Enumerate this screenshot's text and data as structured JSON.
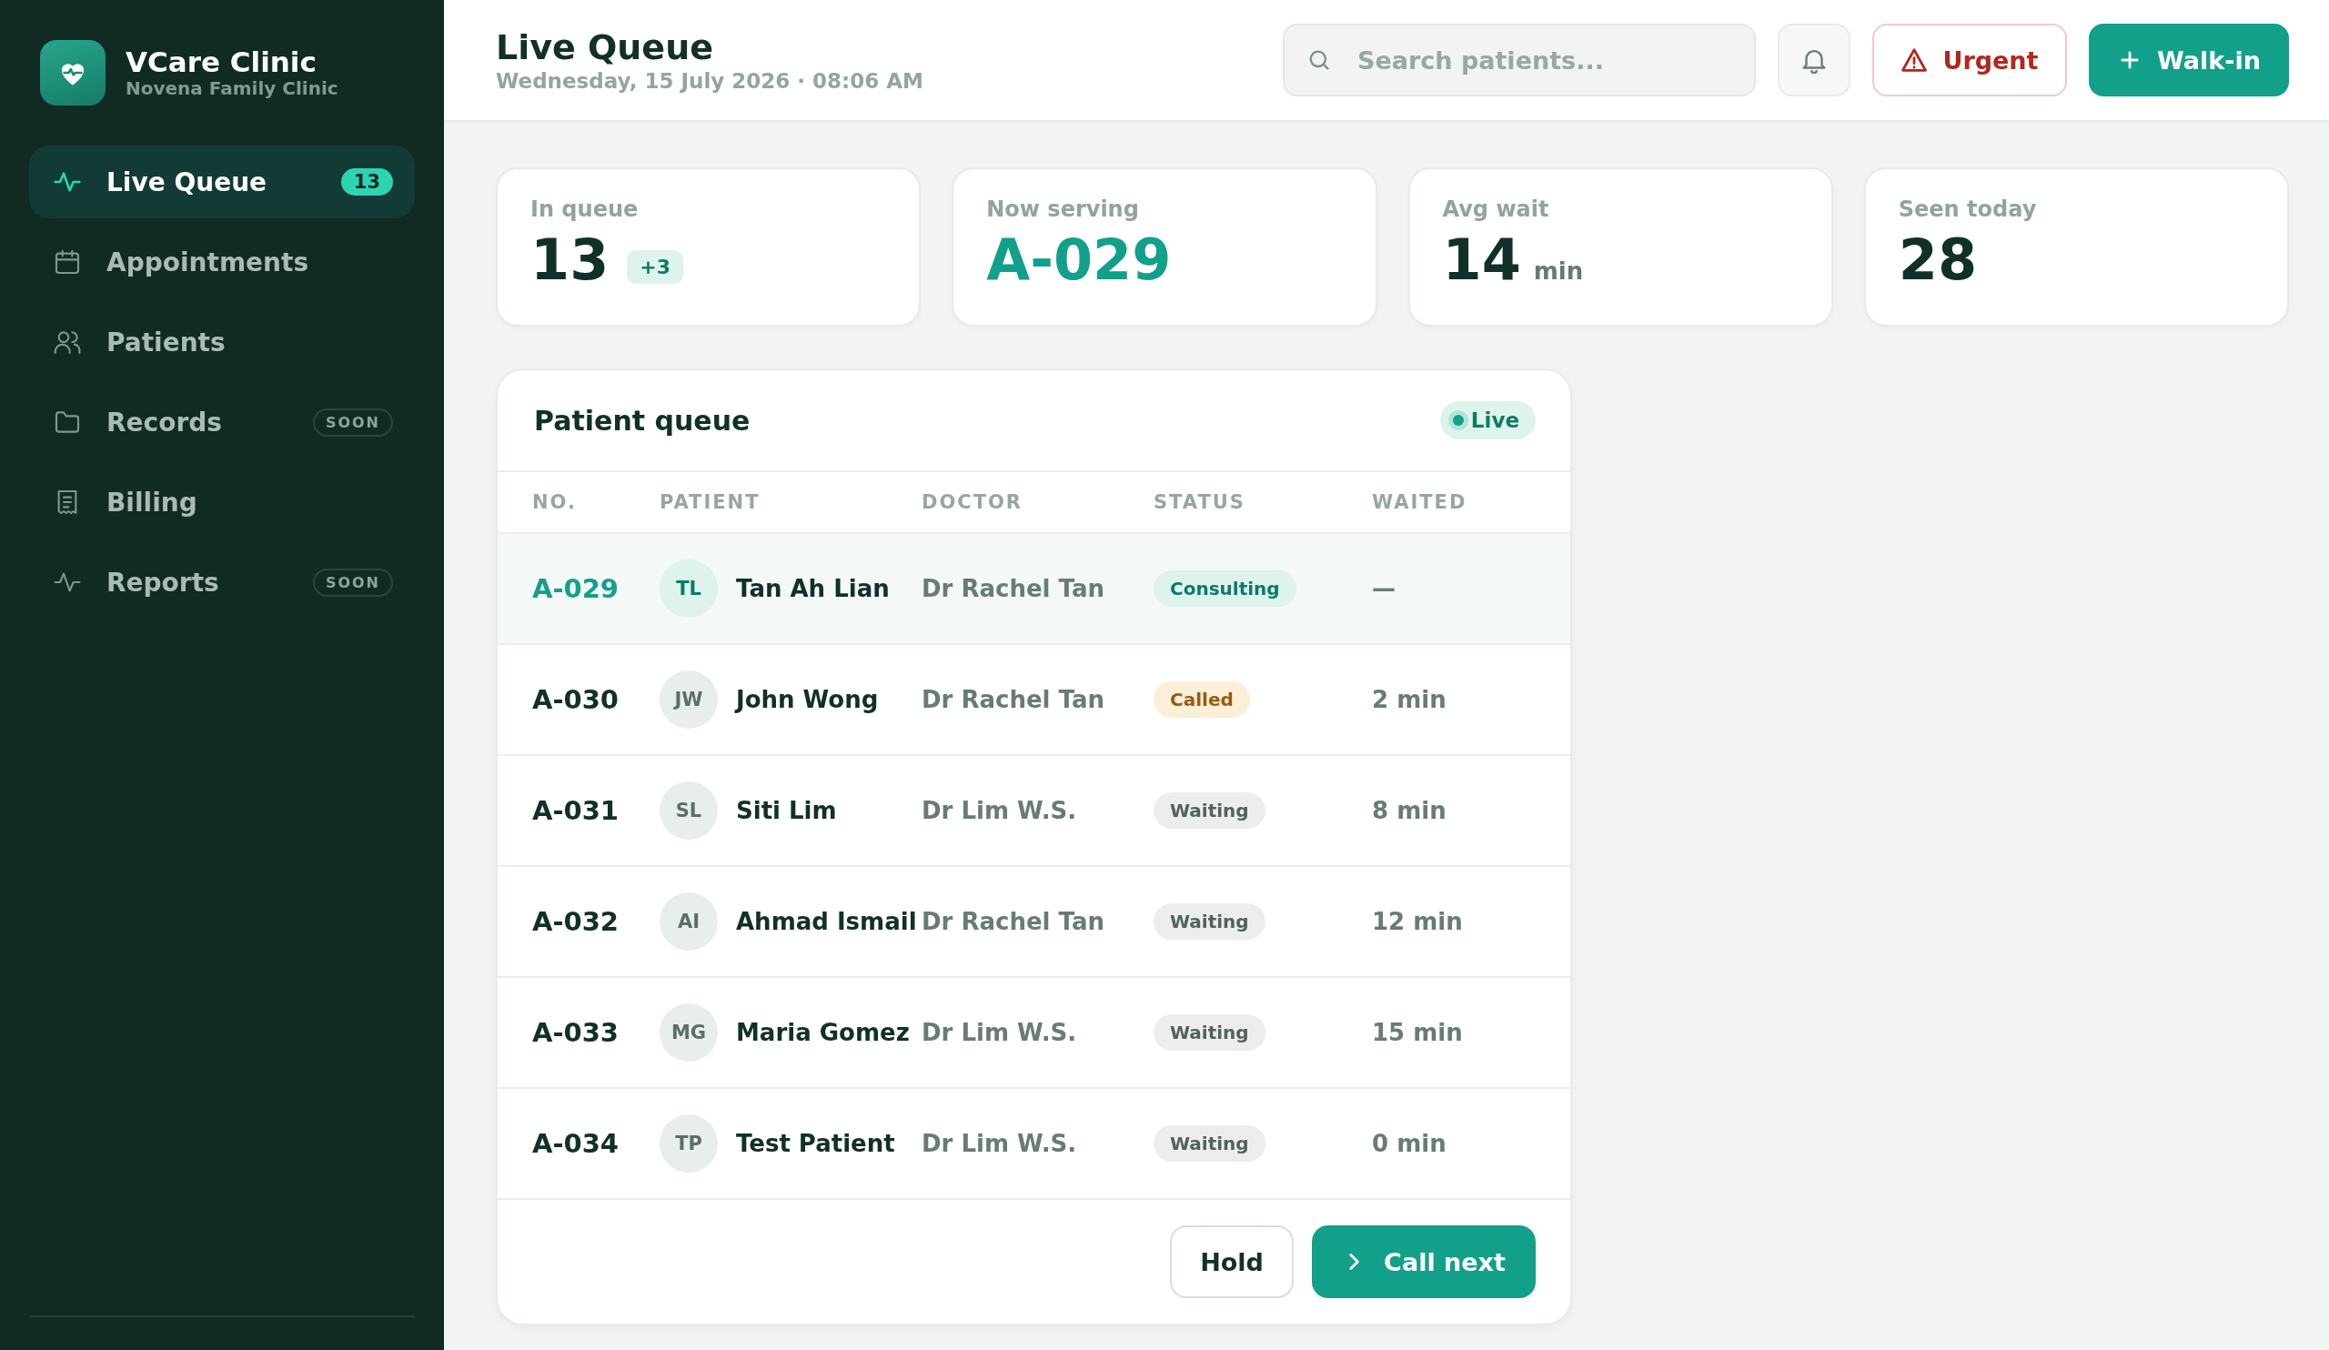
{
  "sidebar": {
    "brand": {
      "name": "VCare Clinic",
      "subtitle": "Novena Family Clinic"
    },
    "items": [
      {
        "label": "Live Queue",
        "selected": true,
        "badge": "13"
      },
      {
        "label": "Appointments",
        "selected": false
      },
      {
        "label": "Patients",
        "selected": false
      },
      {
        "label": "Records",
        "selected": false,
        "tag": "SOON"
      },
      {
        "label": "Billing",
        "selected": false
      },
      {
        "label": "Reports",
        "selected": false,
        "tag": "SOON"
      }
    ]
  },
  "header": {
    "title": "Live Queue",
    "date": "Wednesday, 15 July 2026 · 08:06 AM",
    "search": {
      "placeholder": "Search patients..."
    },
    "urgent_button": "Urgent",
    "walkin_button": "Walk-in"
  },
  "stats": [
    {
      "label": "In queue",
      "value": "13",
      "delta": "+3",
      "kind": "plain"
    },
    {
      "label": "Now serving",
      "value": "A-029",
      "kind": "accent"
    },
    {
      "label": "Avg wait",
      "value": "14",
      "unit": "min",
      "kind": "plain"
    },
    {
      "label": "Seen today",
      "value": "28",
      "kind": "plain"
    }
  ],
  "queue": {
    "title": "Patient queue",
    "live_badge": "Live",
    "columns": [
      "NO.",
      "PATIENT",
      "DOCTOR",
      "STATUS",
      "WAITED"
    ],
    "rows": [
      {
        "no": "A-029",
        "initials": "TL",
        "patient": "Tan Ah Lian",
        "doctor": "Dr Rachel Tan",
        "status": "Consulting",
        "kind": "consulting",
        "waited": "—",
        "selected": true
      },
      {
        "no": "A-030",
        "initials": "JW",
        "patient": "John Wong",
        "doctor": "Dr Rachel Tan",
        "status": "Called",
        "kind": "called",
        "waited": "2 min",
        "selected": false
      },
      {
        "no": "A-031",
        "initials": "SL",
        "patient": "Siti Lim",
        "doctor": "Dr Lim W.S.",
        "status": "Waiting",
        "kind": "waiting",
        "waited": "8 min",
        "selected": false
      },
      {
        "no": "A-032",
        "initials": "AI",
        "patient": "Ahmad Ismail",
        "doctor": "Dr Rachel Tan",
        "status": "Waiting",
        "kind": "waiting",
        "waited": "12 min",
        "selected": false
      },
      {
        "no": "A-033",
        "initials": "MG",
        "patient": "Maria Gomez",
        "doctor": "Dr Lim W.S.",
        "status": "Waiting",
        "kind": "waiting",
        "waited": "15 min",
        "selected": false
      },
      {
        "no": "A-034",
        "initials": "TP",
        "patient": "Test Patient",
        "doctor": "Dr Lim W.S.",
        "status": "Waiting",
        "kind": "waiting",
        "waited": "0 min",
        "selected": false
      }
    ],
    "hold_button": "Hold",
    "call_next_button": "Call next"
  }
}
